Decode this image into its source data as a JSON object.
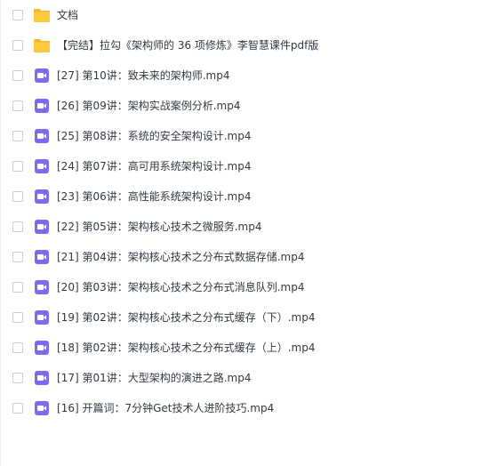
{
  "colors": {
    "folder": "#ffc93f",
    "folder_dark": "#f5b82a",
    "video": "#7a6bf0",
    "text": "#333842",
    "checkbox_border": "#c7ccd6"
  },
  "files": [
    {
      "name": "文档",
      "icon": "folder-icon"
    },
    {
      "name": "【完结】拉勾《架构师的 36 项修炼》李智慧课件pdf版",
      "icon": "folder-icon"
    },
    {
      "name": "[27] 第10讲：致未来的架构师.mp4",
      "icon": "video-icon"
    },
    {
      "name": "[26] 第09讲：架构实战案例分析.mp4",
      "icon": "video-icon"
    },
    {
      "name": "[25] 第08讲：系统的安全架构设计.mp4",
      "icon": "video-icon"
    },
    {
      "name": "[24] 第07讲：高可用系统架构设计.mp4",
      "icon": "video-icon"
    },
    {
      "name": "[23] 第06讲：高性能系统架构设计.mp4",
      "icon": "video-icon"
    },
    {
      "name": "[22] 第05讲：架构核心技术之微服务.mp4",
      "icon": "video-icon"
    },
    {
      "name": "[21] 第04讲：架构核心技术之分布式数据存储.mp4",
      "icon": "video-icon"
    },
    {
      "name": "[20] 第03讲：架构核心技术之分布式消息队列.mp4",
      "icon": "video-icon"
    },
    {
      "name": "[19] 第02讲：架构核心技术之分布式缓存（下）.mp4",
      "icon": "video-icon"
    },
    {
      "name": "[18] 第02讲：架构核心技术之分布式缓存（上）.mp4",
      "icon": "video-icon"
    },
    {
      "name": "[17] 第01讲：大型架构的演进之路.mp4",
      "icon": "video-icon"
    },
    {
      "name": "[16] 开篇词：7分钟Get技术人进阶技巧.mp4",
      "icon": "video-icon"
    }
  ]
}
